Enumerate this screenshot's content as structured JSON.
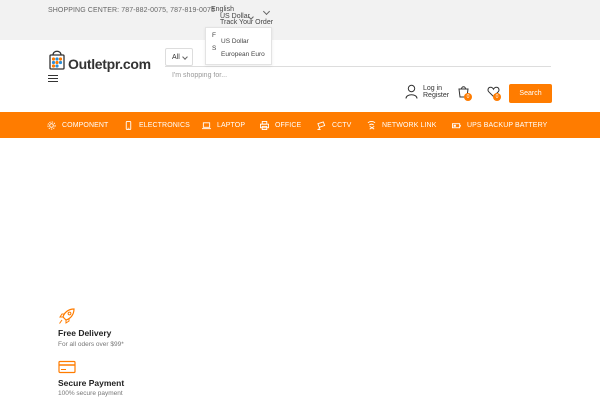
{
  "topbar": {
    "phones": "SHOPPING CENTER: 787-882-0075, 787-819-0075",
    "language": "English",
    "currency_selected": "US Dollar",
    "track_order": "Track Your Order"
  },
  "currency_dropdown": {
    "options": [
      "US Dollar",
      "European Euro"
    ],
    "fragment_1": "F",
    "fragment_2": "S"
  },
  "header": {
    "logo": "Outletpr.com",
    "category_select": "All",
    "search_placeholder": "I'm shopping for...",
    "login": "Log in",
    "register": "Register",
    "cart_count": "0",
    "wishlist_count": "0",
    "search_button": "Search"
  },
  "nav": {
    "items": [
      {
        "label": "COMPONENT",
        "icon": "gear-icon"
      },
      {
        "label": "ELECTRONICS",
        "icon": "phone-icon"
      },
      {
        "label": "LAPTOP",
        "icon": "laptop-icon"
      },
      {
        "label": "OFFICE",
        "icon": "printer-icon"
      },
      {
        "label": "CCTV",
        "icon": "camera-icon"
      },
      {
        "label": "NETWORK LINK",
        "icon": "network-icon"
      },
      {
        "label": "UPS BACKUP BATTERY",
        "icon": "battery-icon"
      }
    ]
  },
  "features": [
    {
      "title": "Free Delivery",
      "subtitle": "For all oders over $99*",
      "icon": "rocket-icon"
    },
    {
      "title": "Secure Payment",
      "subtitle": "100% secure payment",
      "icon": "credit-card-icon"
    }
  ],
  "colors": {
    "accent": "#ff7c00",
    "topbar_bg": "#f2f2f2"
  }
}
